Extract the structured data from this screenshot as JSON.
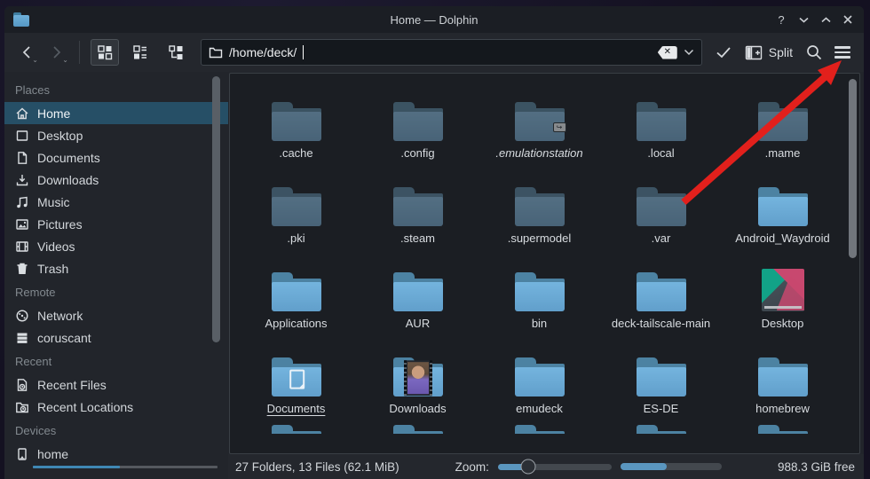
{
  "window": {
    "title": "Home — Dolphin",
    "controls": {
      "help": "?"
    }
  },
  "toolbar": {
    "location_path": "/home/deck/",
    "split_label": "Split"
  },
  "sidebar": {
    "sections": [
      {
        "title": "Places",
        "items": [
          {
            "label": "Home",
            "icon": "home-icon",
            "selected": true
          },
          {
            "label": "Desktop",
            "icon": "desktop-icon"
          },
          {
            "label": "Documents",
            "icon": "document-icon"
          },
          {
            "label": "Downloads",
            "icon": "download-icon"
          },
          {
            "label": "Music",
            "icon": "music-icon"
          },
          {
            "label": "Pictures",
            "icon": "picture-icon"
          },
          {
            "label": "Videos",
            "icon": "video-icon"
          },
          {
            "label": "Trash",
            "icon": "trash-icon"
          }
        ]
      },
      {
        "title": "Remote",
        "items": [
          {
            "label": "Network",
            "icon": "network-icon"
          },
          {
            "label": "coruscant",
            "icon": "server-icon"
          }
        ]
      },
      {
        "title": "Recent",
        "items": [
          {
            "label": "Recent Files",
            "icon": "recent-files-icon"
          },
          {
            "label": "Recent Locations",
            "icon": "recent-locations-icon"
          }
        ]
      },
      {
        "title": "Devices",
        "items": [
          {
            "label": "home",
            "icon": "harddrive-icon",
            "usage_percent": 47
          }
        ]
      }
    ]
  },
  "files": {
    "items": [
      {
        "name": ".cache",
        "hidden": true,
        "variant": "folder"
      },
      {
        "name": ".config",
        "hidden": true,
        "variant": "folder"
      },
      {
        "name": ".emulationstation",
        "hidden": true,
        "variant": "link",
        "italic": true
      },
      {
        "name": ".local",
        "hidden": true,
        "variant": "folder"
      },
      {
        "name": ".mame",
        "hidden": true,
        "variant": "folder"
      },
      {
        "name": ".pki",
        "hidden": true,
        "variant": "folder"
      },
      {
        "name": ".steam",
        "hidden": true,
        "variant": "folder"
      },
      {
        "name": ".supermodel",
        "hidden": true,
        "variant": "folder"
      },
      {
        "name": ".var",
        "hidden": true,
        "variant": "folder"
      },
      {
        "name": "Android_Waydroid",
        "hidden": false,
        "variant": "folder"
      },
      {
        "name": "Applications",
        "hidden": false,
        "variant": "folder"
      },
      {
        "name": "AUR",
        "hidden": false,
        "variant": "folder"
      },
      {
        "name": "bin",
        "hidden": false,
        "variant": "folder"
      },
      {
        "name": "deck-tailscale-main",
        "hidden": false,
        "variant": "folder"
      },
      {
        "name": "Desktop",
        "hidden": false,
        "variant": "desktop"
      },
      {
        "name": "Documents",
        "hidden": false,
        "variant": "documents",
        "underline": true
      },
      {
        "name": "Downloads",
        "hidden": false,
        "variant": "downloads"
      },
      {
        "name": "emudeck",
        "hidden": false,
        "variant": "folder"
      },
      {
        "name": "ES-DE",
        "hidden": false,
        "variant": "folder"
      },
      {
        "name": "homebrew",
        "hidden": false,
        "variant": "folder"
      }
    ],
    "peek_row_folder_count": 5
  },
  "statusbar": {
    "summary": "27 Folders, 13 Files (62.1 MiB)",
    "zoom_label": "Zoom:",
    "zoom_percent": 27,
    "capacity_percent": 46,
    "free_space": "988.3 GiB free"
  },
  "annotation": {
    "arrow_points_at": "menu-button",
    "arrow_color": "#e2201c"
  },
  "colors": {
    "accent": "#3daee9",
    "selection": "#264f66",
    "folder_front": "#69a9d3",
    "titlebar": "#1b1e24",
    "toolbar": "#24272d",
    "view_bg": "#1b1e23"
  }
}
